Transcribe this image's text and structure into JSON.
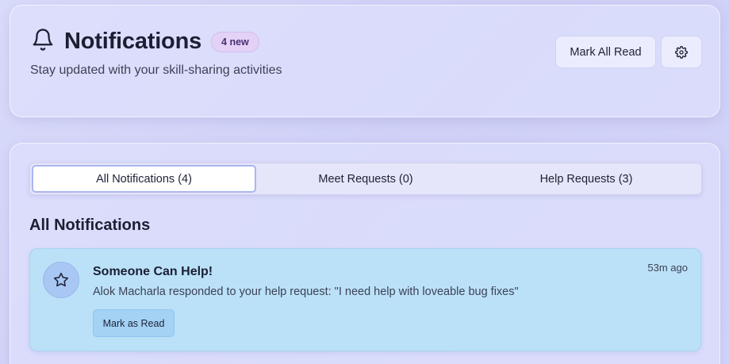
{
  "header": {
    "title": "Notifications",
    "new_badge": "4 new",
    "subtitle": "Stay updated with your skill-sharing activities",
    "mark_all_read_label": "Mark All Read"
  },
  "tabs": [
    {
      "label": "All Notifications (4)",
      "active": true
    },
    {
      "label": "Meet Requests (0)",
      "active": false
    },
    {
      "label": "Help Requests (3)",
      "active": false
    }
  ],
  "section": {
    "title": "All Notifications"
  },
  "notifications": [
    {
      "icon": "star-icon",
      "title": "Someone Can Help!",
      "body": "Alok Macharla responded to your help request: \"I need help with loveable bug fixes\"",
      "time": "53m ago",
      "action_label": "Mark as Read"
    }
  ],
  "colors": {
    "notification_bg": "#bbe1f8",
    "badge_bg": "#e3d2f6",
    "active_tab_border": "#a9b6ef"
  }
}
